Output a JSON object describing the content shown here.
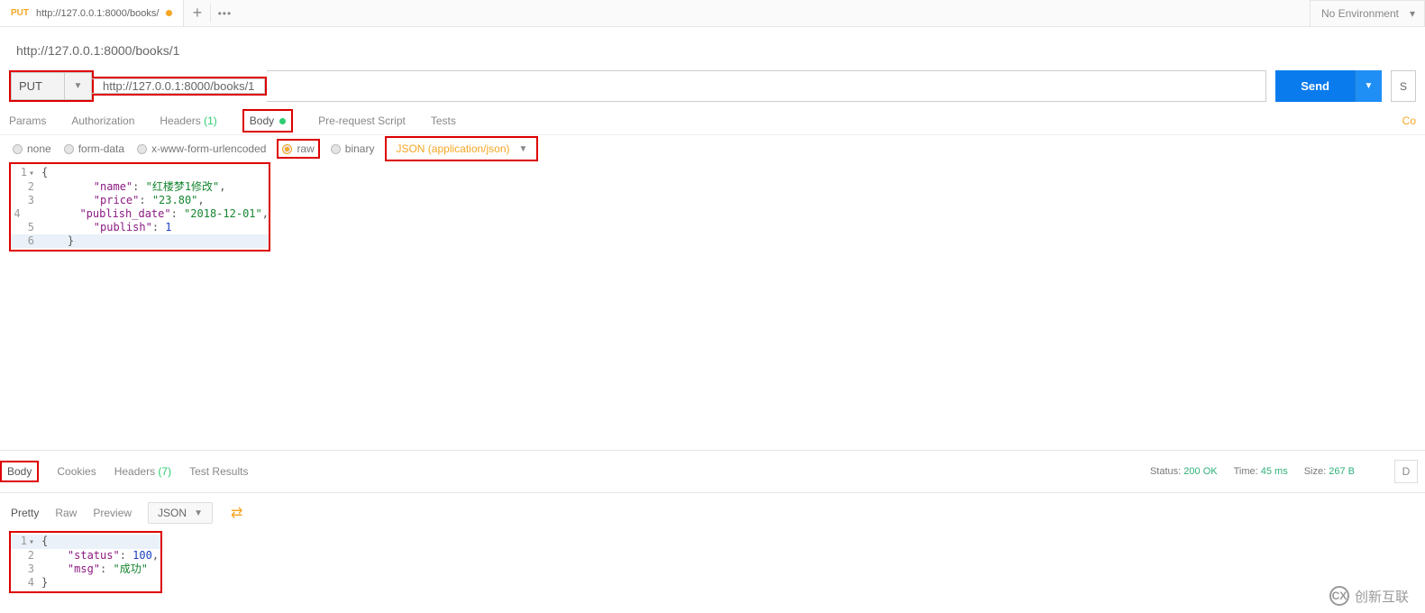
{
  "tab": {
    "method": "PUT",
    "title": "http://127.0.0.1:8000/books/"
  },
  "env": {
    "label": "No Environment"
  },
  "request": {
    "title": "http://127.0.0.1:8000/books/1",
    "method": "PUT",
    "url": "http://127.0.0.1:8000/books/1",
    "send": "Send",
    "save_short": "S"
  },
  "req_tabs": {
    "params": "Params",
    "authorization": "Authorization",
    "headers": "Headers",
    "headers_count": "(1)",
    "body": "Body",
    "prerequest": "Pre-request Script",
    "tests": "Tests",
    "co": "Co"
  },
  "body_types": {
    "none": "none",
    "formdata": "form-data",
    "xwww": "x-www-form-urlencoded",
    "raw": "raw",
    "binary": "binary",
    "content_type": "JSON (application/json)"
  },
  "request_body": {
    "lines": [
      "1",
      "2",
      "3",
      "4",
      "5",
      "6"
    ],
    "l1": "{",
    "l2_k": "\"name\"",
    "l2_v": "\"红楼梦1修改\"",
    "l3_k": "\"price\"",
    "l3_v": "\"23.80\"",
    "l4_k": "\"publish_date\"",
    "l4_v": "\"2018-12-01\"",
    "l5_k": "\"publish\"",
    "l5_v": "1",
    "l6": "}"
  },
  "response_tabs": {
    "body": "Body",
    "cookies": "Cookies",
    "headers": "Headers",
    "headers_count": "(7)",
    "test_results": "Test Results"
  },
  "response_meta": {
    "status_label": "Status:",
    "status_value": "200 OK",
    "time_label": "Time:",
    "time_value": "45 ms",
    "size_label": "Size:",
    "size_value": "267 B"
  },
  "view_row": {
    "pretty": "Pretty",
    "raw": "Raw",
    "preview": "Preview",
    "json": "JSON"
  },
  "response_body": {
    "lines": [
      "1",
      "2",
      "3",
      "4"
    ],
    "l1": "{",
    "l2_k": "\"status\"",
    "l2_v": "100",
    "l3_k": "\"msg\"",
    "l3_v": "\"成功\"",
    "l4": "}"
  },
  "watermark": {
    "text": "创新互联",
    "logo": "CX"
  }
}
